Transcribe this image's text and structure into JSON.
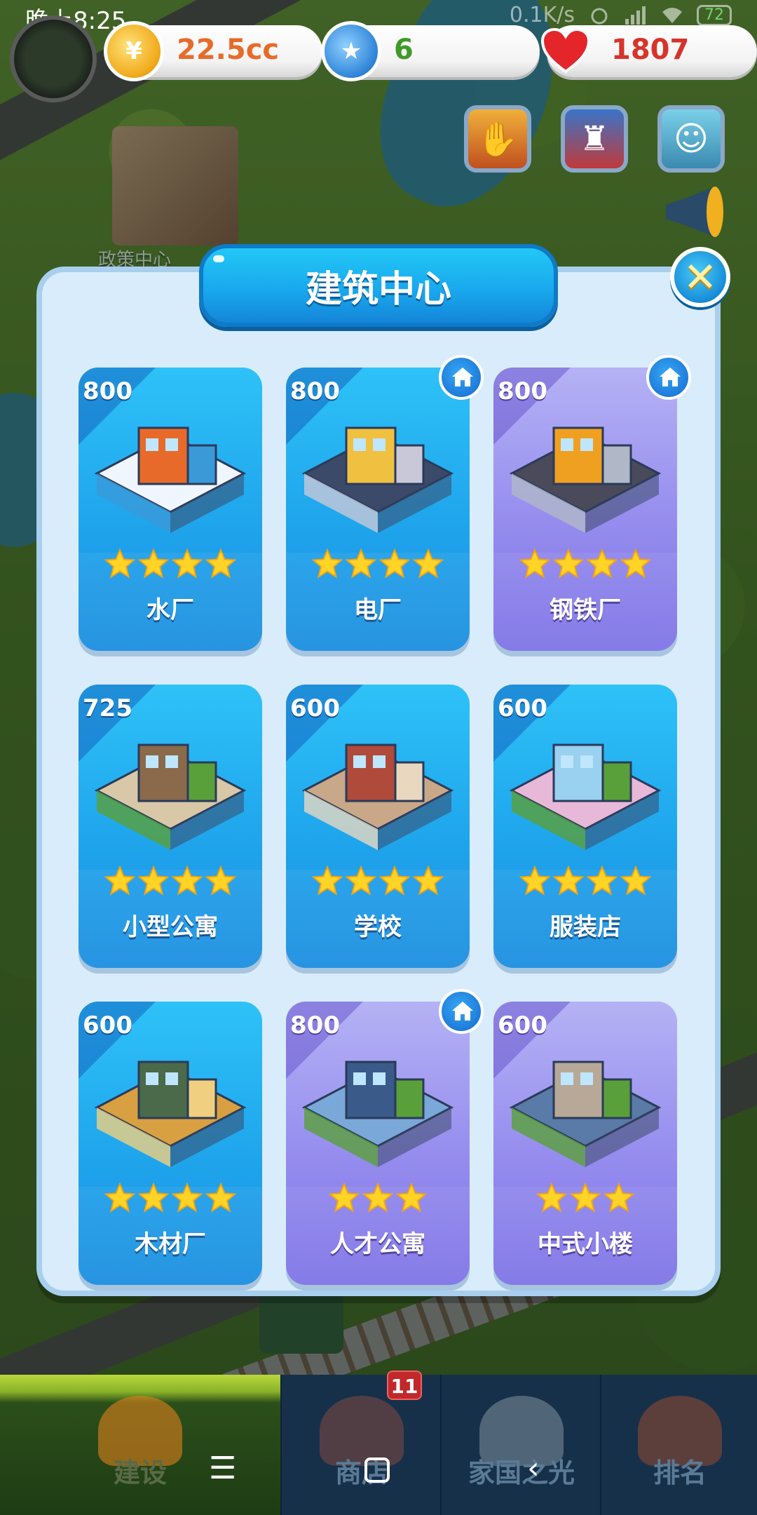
{
  "status_bar": {
    "time": "晚上8:25",
    "net_speed": "0.1K/s",
    "battery": "72"
  },
  "resources": {
    "coins": "22.5cc",
    "stars": "6",
    "hearts": "1807"
  },
  "map": {
    "building_label": "政策中心"
  },
  "modal": {
    "title": "建筑中心",
    "close_icon": "close-x"
  },
  "buildings": [
    {
      "price": "800",
      "name": "水厂",
      "stars": 4,
      "style": "blue",
      "owned": false
    },
    {
      "price": "800",
      "name": "电厂",
      "stars": 4,
      "style": "blue",
      "owned": true
    },
    {
      "price": "800",
      "name": "钢铁厂",
      "stars": 4,
      "style": "purple",
      "owned": true
    },
    {
      "price": "725",
      "name": "小型公寓",
      "stars": 4,
      "style": "blue",
      "owned": false
    },
    {
      "price": "600",
      "name": "学校",
      "stars": 4,
      "style": "blue",
      "owned": false
    },
    {
      "price": "600",
      "name": "服装店",
      "stars": 4,
      "style": "blue",
      "owned": false
    },
    {
      "price": "600",
      "name": "木材厂",
      "stars": 4,
      "style": "blue",
      "owned": false
    },
    {
      "price": "800",
      "name": "人才公寓",
      "stars": 3,
      "style": "purple",
      "owned": true
    },
    {
      "price": "600",
      "name": "中式小楼",
      "stars": 3,
      "style": "purple",
      "owned": false
    }
  ],
  "bottom_nav": {
    "tabs": [
      {
        "label": "建设",
        "icon": "hardhat-icon"
      },
      {
        "label": "商店",
        "icon": "shop-icon"
      },
      {
        "label": "家国之光",
        "icon": "rocket-icon"
      },
      {
        "label": "排名",
        "icon": "trophy-icon"
      }
    ],
    "shop_badge": "11"
  },
  "colors": {
    "card_blue": "#1fa5ec",
    "card_purple": "#958cee",
    "modal_bg": "#d9ecfb",
    "star": "#ffd21a"
  }
}
